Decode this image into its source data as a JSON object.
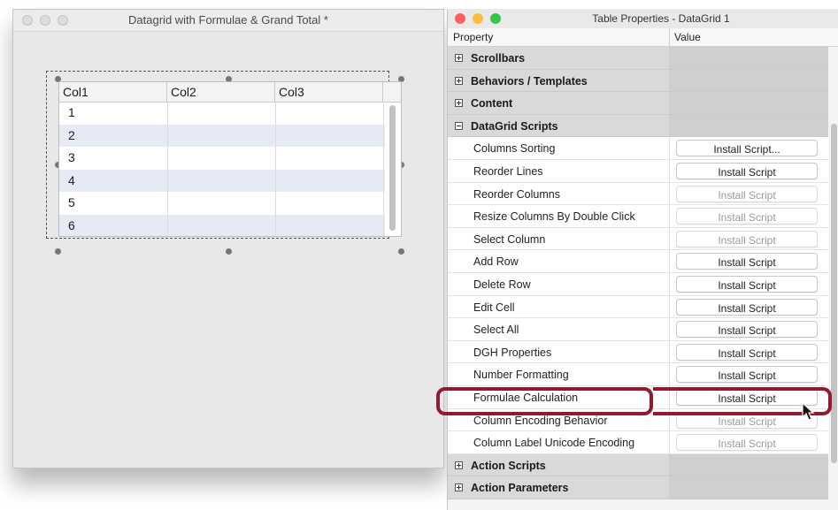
{
  "left_window": {
    "title": "Datagrid with Formulae & Grand Total *",
    "grid": {
      "columns": [
        "Col1",
        "Col2",
        "Col3"
      ],
      "rows": [
        "1",
        "2",
        "3",
        "4",
        "5",
        "6"
      ]
    }
  },
  "right_window": {
    "title": "Table Properties - DataGrid 1",
    "column_headers": {
      "property": "Property",
      "value": "Value"
    },
    "rows": [
      {
        "type": "section",
        "expanded": false,
        "label": "Scrollbars"
      },
      {
        "type": "section",
        "expanded": false,
        "label": "Behaviors / Templates"
      },
      {
        "type": "section",
        "expanded": false,
        "label": "Content"
      },
      {
        "type": "section",
        "expanded": true,
        "label": "DataGrid Scripts"
      },
      {
        "type": "item",
        "label": "Columns Sorting",
        "button": "Install Script...",
        "enabled": true
      },
      {
        "type": "item",
        "label": "Reorder Lines",
        "button": "Install Script",
        "enabled": true
      },
      {
        "type": "item",
        "label": "Reorder Columns",
        "button": "Install Script",
        "enabled": false
      },
      {
        "type": "item",
        "label": "Resize Columns By Double Click",
        "button": "Install Script",
        "enabled": false
      },
      {
        "type": "item",
        "label": "Select Column",
        "button": "Install Script",
        "enabled": false
      },
      {
        "type": "item",
        "label": "Add Row",
        "button": "Install Script",
        "enabled": true
      },
      {
        "type": "item",
        "label": "Delete Row",
        "button": "Install Script",
        "enabled": true
      },
      {
        "type": "item",
        "label": "Edit Cell",
        "button": "Install Script",
        "enabled": true
      },
      {
        "type": "item",
        "label": "Select All",
        "button": "Install Script",
        "enabled": true
      },
      {
        "type": "item",
        "label": "DGH Properties",
        "button": "Install Script",
        "enabled": true
      },
      {
        "type": "item",
        "label": "Number Formatting",
        "button": "Install Script",
        "enabled": true
      },
      {
        "type": "item",
        "label": "Formulae Calculation",
        "button": "Install Script",
        "enabled": true
      },
      {
        "type": "item",
        "label": "Column Encoding Behavior",
        "button": "Install Script",
        "enabled": false
      },
      {
        "type": "item",
        "label": "Column Label Unicode Encoding",
        "button": "Install Script",
        "enabled": false
      },
      {
        "type": "section",
        "expanded": false,
        "label": "Action Scripts"
      },
      {
        "type": "section",
        "expanded": false,
        "label": "Action Parameters"
      }
    ]
  },
  "colors": {
    "highlight": "#8f1b2d",
    "close": "#fc605c",
    "minimize": "#fdbc40",
    "zoom": "#34c84a"
  },
  "icons": [
    "expand-plus-icon",
    "collapse-minus-icon",
    "mouse-pointer-icon"
  ]
}
